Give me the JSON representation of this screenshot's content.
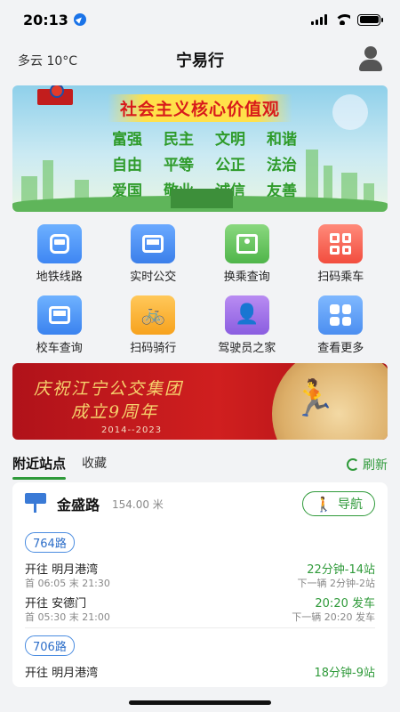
{
  "status_bar": {
    "time": "20:13"
  },
  "header": {
    "weather": "多云 10°C",
    "title": "宁易行"
  },
  "banner": {
    "heading": "社会主义核心价值观",
    "values": [
      "富强",
      "民主",
      "文明",
      "和谐",
      "自由",
      "平等",
      "公正",
      "法治",
      "爱国",
      "敬业",
      "诚信",
      "友善"
    ]
  },
  "functions": [
    {
      "label": "地铁线路",
      "icon": "metro-icon"
    },
    {
      "label": "实时公交",
      "icon": "bus-icon"
    },
    {
      "label": "换乘查询",
      "icon": "map-icon"
    },
    {
      "label": "扫码乘车",
      "icon": "qr-code-icon"
    },
    {
      "label": "校车查询",
      "icon": "school-bus-icon"
    },
    {
      "label": "扫码骑行",
      "icon": "bike-icon"
    },
    {
      "label": "驾驶员之家",
      "icon": "driver-icon"
    },
    {
      "label": "查看更多",
      "icon": "grid-icon"
    }
  ],
  "anniversary": {
    "line1": "庆祝江宁公交集团",
    "line2": "成立9周年",
    "years": "2014--2023"
  },
  "tabs": {
    "nearby": "附近站点",
    "favorites": "收藏",
    "refresh": "刷新"
  },
  "station": {
    "name": "金盛路",
    "distance": "154.00 米",
    "nav_label": "导航",
    "routes": [
      {
        "name": "764路",
        "directions": [
          {
            "dest": "开往 明月港湾",
            "times": "首 06:05  末 21:30",
            "eta": "22分钟-14站",
            "next": "下一辆 2分钟-2站"
          },
          {
            "dest": "开往 安德门",
            "times": "首 05:30  末 21:00",
            "eta": "20:20 发车",
            "next": "下一辆 20:20 发车"
          }
        ]
      },
      {
        "name": "706路",
        "directions": [
          {
            "dest": "开往 明月港湾",
            "eta": "18分钟-9站"
          }
        ]
      }
    ]
  },
  "colors": {
    "accent_green": "#2f9a3a",
    "route_blue": "#4a8ce0",
    "banner_red": "#d01f1f"
  }
}
